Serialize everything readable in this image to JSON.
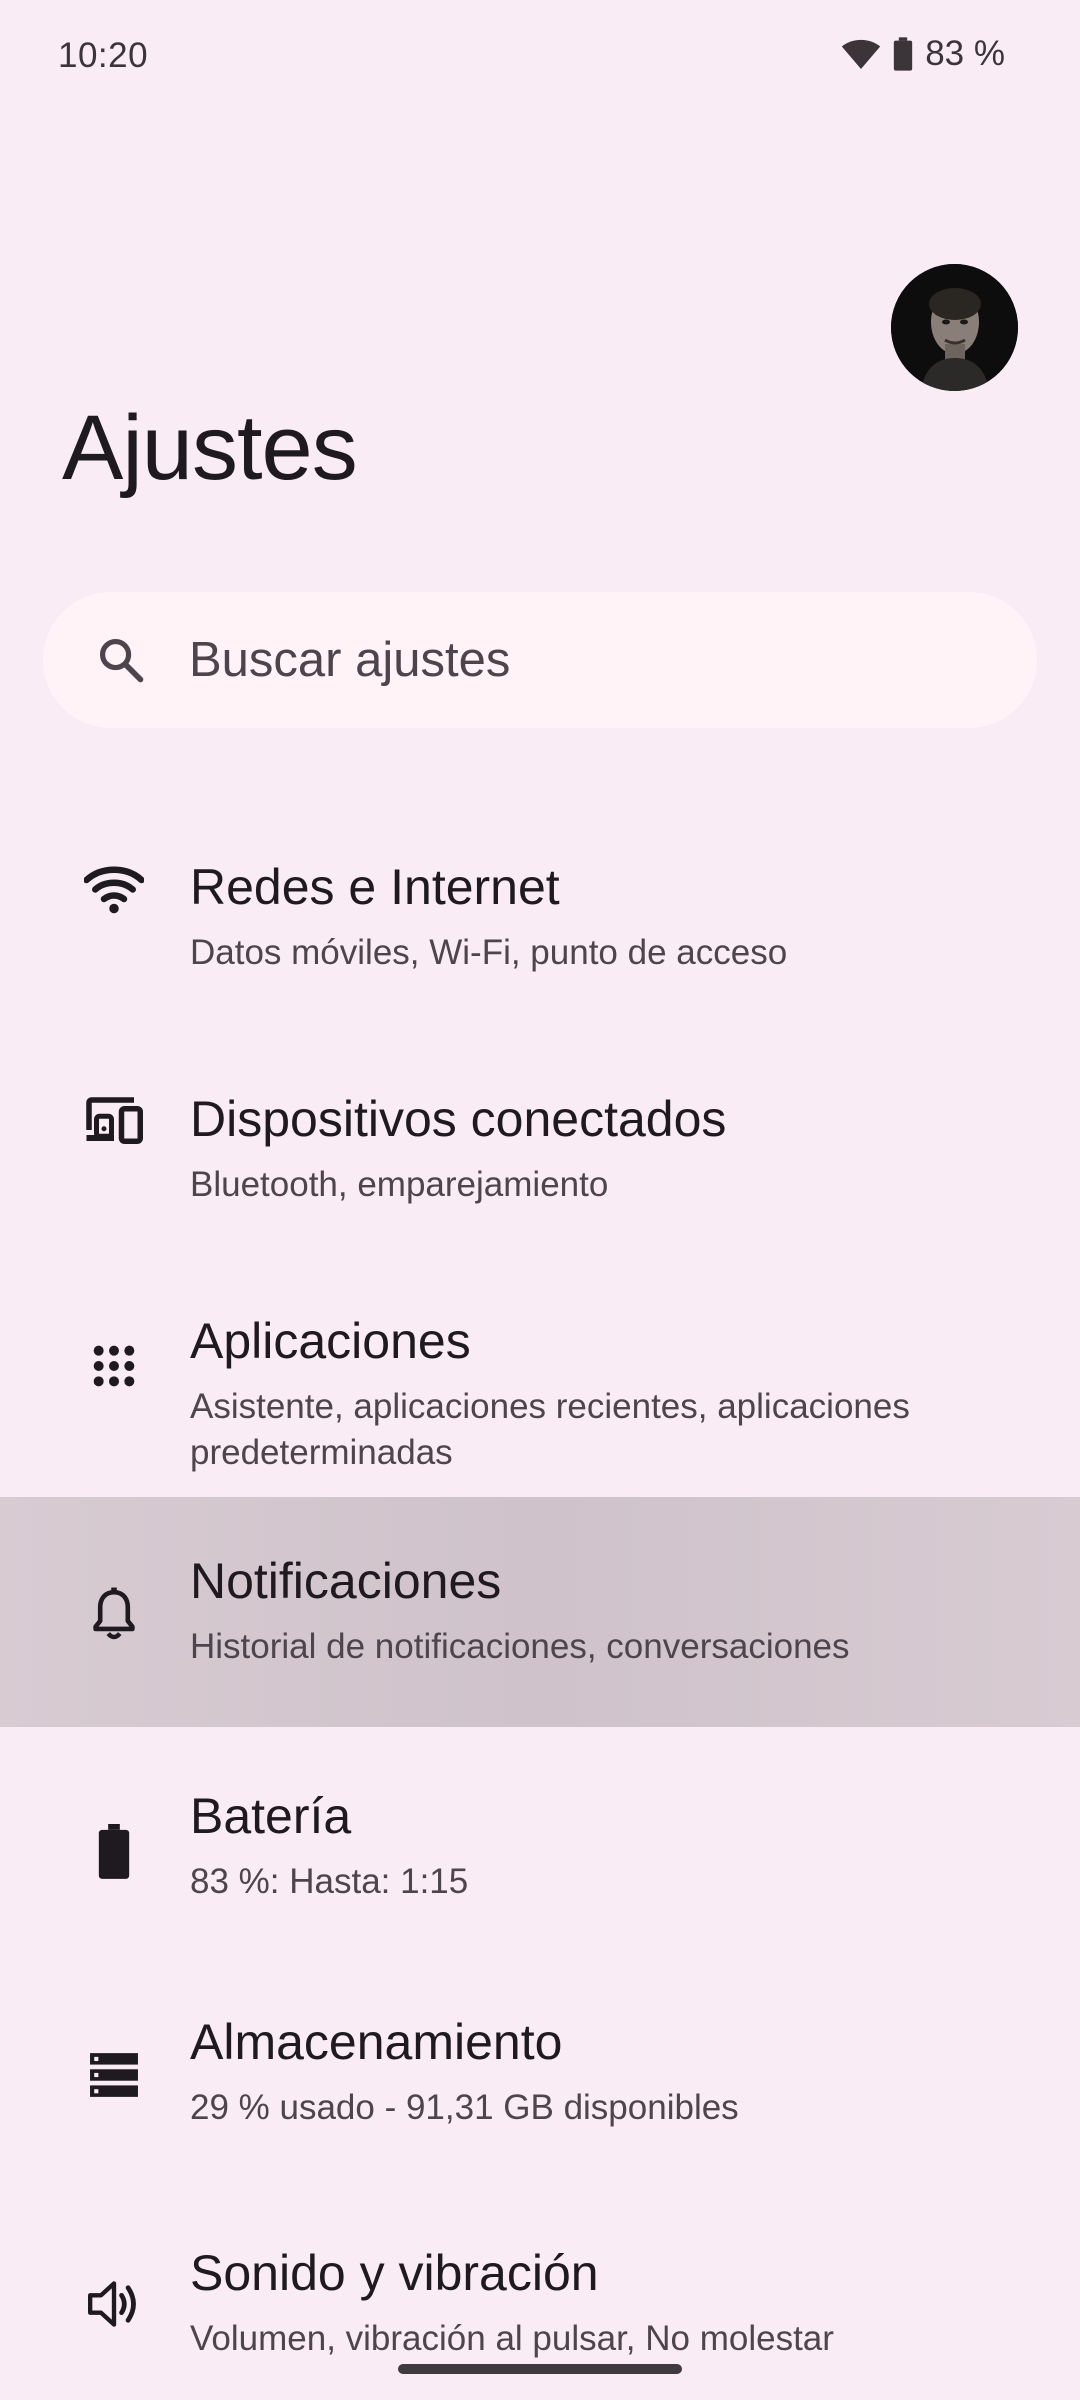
{
  "status_bar": {
    "time": "10:20",
    "battery_percent": "83 %"
  },
  "header": {
    "title": "Ajustes"
  },
  "search": {
    "placeholder": "Buscar ajustes"
  },
  "settings": [
    {
      "title": "Redes e Internet",
      "subtitle": "Datos móviles, Wi-Fi, punto de acceso",
      "icon": "wifi-icon"
    },
    {
      "title": "Dispositivos conectados",
      "subtitle": "Bluetooth, emparejamiento",
      "icon": "connected-devices-icon"
    },
    {
      "title": "Aplicaciones",
      "subtitle": "Asistente, aplicaciones recientes, aplicaciones predeterminadas",
      "icon": "apps-grid-icon"
    },
    {
      "title": "Notificaciones",
      "subtitle": "Historial de notificaciones, conversaciones",
      "icon": "bell-icon",
      "highlighted": true
    },
    {
      "title": "Batería",
      "subtitle": "83 %: Hasta: 1:15",
      "icon": "battery-icon"
    },
    {
      "title": "Almacenamiento",
      "subtitle": "29 % usado - 91,31 GB disponibles",
      "icon": "storage-icon"
    },
    {
      "title": "Sonido y vibración",
      "subtitle": "Volumen, vibración al pulsar, No molestar",
      "icon": "volume-icon"
    }
  ],
  "colors": {
    "background": "#f9ecf4",
    "search_background": "#fff3f8",
    "highlight": "#d2c5cd",
    "text_primary": "#1e1a1f",
    "text_secondary": "#4d454b"
  }
}
